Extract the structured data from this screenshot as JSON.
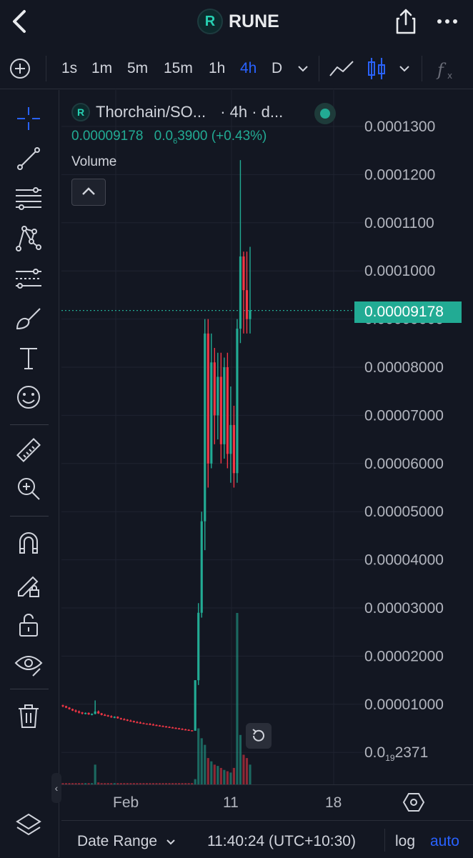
{
  "header": {
    "title": "RUNE",
    "logo_letter": "R"
  },
  "toolbar": {
    "timeframes": [
      "1s",
      "1m",
      "5m",
      "15m",
      "1h",
      "4h",
      "D"
    ],
    "active_timeframe": "4h"
  },
  "legend": {
    "symbol": "Thorchain/SO...",
    "meta": "· 4h · d...",
    "last": "0.00009178",
    "change_prefix": "0.0",
    "change_sub": "6",
    "change_rest": "3900 (+0.43%)",
    "volume_label": "Volume"
  },
  "price_axis": {
    "labels": [
      "0.0001300",
      "0.0001200",
      "0.0001100",
      "0.0001000",
      "0.00009000",
      "0.00008000",
      "0.00007000",
      "0.00006000",
      "0.00005000",
      "0.00004000",
      "0.00003000",
      "0.00002000",
      "0.00001000"
    ],
    "bottom_label_prefix": "0.0",
    "bottom_label_sub": "19",
    "bottom_label_rest": "2371",
    "last_price": "0.00009178"
  },
  "time_axis": {
    "labels": [
      "Feb",
      "11",
      "18"
    ]
  },
  "bottom_bar": {
    "date_range": "Date Range",
    "clock": "11:40:24 (UTC+10:30)",
    "log": "log",
    "auto": "auto"
  },
  "colors": {
    "up": "#22ab94",
    "down": "#f23645",
    "accent": "#2962ff",
    "background": "#131722"
  },
  "chart_data": {
    "type": "candlestick",
    "timeframe": "4h",
    "price_range": [
      2.4e-06,
      0.000135
    ],
    "candles": [
      {
        "o": 9.8e-06,
        "h": 9.9e-06,
        "l": 9.4e-06,
        "c": 9.6e-06
      },
      {
        "o": 9.6e-06,
        "h": 9.7e-06,
        "l": 9.2e-06,
        "c": 9.3e-06
      },
      {
        "o": 9.3e-06,
        "h": 9.4e-06,
        "l": 8.9e-06,
        "c": 9e-06
      },
      {
        "o": 9e-06,
        "h": 9.1e-06,
        "l": 8.6e-06,
        "c": 8.7e-06
      },
      {
        "o": 8.7e-06,
        "h": 8.9e-06,
        "l": 8.3e-06,
        "c": 8.5e-06
      },
      {
        "o": 8.5e-06,
        "h": 8.7e-06,
        "l": 8.1e-06,
        "c": 8.3e-06
      },
      {
        "o": 8.3e-06,
        "h": 8.4e-06,
        "l": 7.9e-06,
        "c": 8.1e-06
      },
      {
        "o": 8.1e-06,
        "h": 8.3e-06,
        "l": 7.9e-06,
        "c": 8.2e-06
      },
      {
        "o": 8.2e-06,
        "h": 8.3e-06,
        "l": 7.8e-06,
        "c": 7.9e-06
      },
      {
        "o": 7.9e-06,
        "h": 8.1e-06,
        "l": 7.7e-06,
        "c": 8e-06
      },
      {
        "o": 8e-06,
        "h": 1.08e-05,
        "l": 7.9e-06,
        "c": 8.5e-06
      },
      {
        "o": 8.5e-06,
        "h": 8.7e-06,
        "l": 8e-06,
        "c": 8.1e-06
      },
      {
        "o": 8.1e-06,
        "h": 8.2e-06,
        "l": 7.7e-06,
        "c": 7.8e-06
      },
      {
        "o": 7.8e-06,
        "h": 8e-06,
        "l": 7.6e-06,
        "c": 7.7e-06
      },
      {
        "o": 7.7e-06,
        "h": 7.8e-06,
        "l": 7.4e-06,
        "c": 7.5e-06
      },
      {
        "o": 7.5e-06,
        "h": 7.7e-06,
        "l": 7.2e-06,
        "c": 7.3e-06
      },
      {
        "o": 7.3e-06,
        "h": 7.5e-06,
        "l": 7.1e-06,
        "c": 7.4e-06
      },
      {
        "o": 7.4e-06,
        "h": 7.5e-06,
        "l": 7e-06,
        "c": 7.1e-06
      },
      {
        "o": 7.1e-06,
        "h": 7.2e-06,
        "l": 6.8e-06,
        "c": 6.9e-06
      },
      {
        "o": 6.9e-06,
        "h": 7.1e-06,
        "l": 6.7e-06,
        "c": 6.8e-06
      },
      {
        "o": 6.8e-06,
        "h": 6.9e-06,
        "l": 6.5e-06,
        "c": 6.6e-06
      },
      {
        "o": 6.6e-06,
        "h": 6.8e-06,
        "l": 6.4e-06,
        "c": 6.5e-06
      },
      {
        "o": 6.5e-06,
        "h": 6.6e-06,
        "l": 6.2e-06,
        "c": 6.3e-06
      },
      {
        "o": 6.3e-06,
        "h": 6.5e-06,
        "l": 6.1e-06,
        "c": 6.2e-06
      },
      {
        "o": 6.2e-06,
        "h": 6.4e-06,
        "l": 6e-06,
        "c": 6.1e-06
      },
      {
        "o": 6.1e-06,
        "h": 6.2e-06,
        "l": 5.9e-06,
        "c": 6e-06
      },
      {
        "o": 6e-06,
        "h": 3.5e-06,
        "l": 5.8e-06,
        "c": 5.9e-06
      },
      {
        "o": 5.9e-06,
        "h": 6.1e-06,
        "l": 5.7e-06,
        "c": 5.8e-06
      },
      {
        "o": 5.8e-06,
        "h": 6e-06,
        "l": 5.6e-06,
        "c": 5.7e-06
      },
      {
        "o": 5.7e-06,
        "h": 5.8e-06,
        "l": 5.5e-06,
        "c": 5.6e-06
      },
      {
        "o": 5.6e-06,
        "h": 5.7e-06,
        "l": 5.4e-06,
        "c": 5.5e-06
      },
      {
        "o": 5.5e-06,
        "h": 5.6e-06,
        "l": 5.3e-06,
        "c": 5.4e-06
      },
      {
        "o": 5.4e-06,
        "h": 5.5e-06,
        "l": 5.2e-06,
        "c": 5.3e-06
      },
      {
        "o": 5.3e-06,
        "h": 5.4e-06,
        "l": 5.1e-06,
        "c": 5.2e-06
      },
      {
        "o": 5.2e-06,
        "h": 5.3e-06,
        "l": 5e-06,
        "c": 5.1e-06
      },
      {
        "o": 5.1e-06,
        "h": 5.2e-06,
        "l": 4.9e-06,
        "c": 5e-06
      },
      {
        "o": 5e-06,
        "h": 5.1e-06,
        "l": 4.8e-06,
        "c": 4.9e-06
      },
      {
        "o": 4.9e-06,
        "h": 5e-06,
        "l": 4.7e-06,
        "c": 4.8e-06
      },
      {
        "o": 4.8e-06,
        "h": 4.9e-06,
        "l": 4.6e-06,
        "c": 4.7e-06
      },
      {
        "o": 4.7e-06,
        "h": 4.8e-06,
        "l": 4.5e-06,
        "c": 4.6e-06
      },
      {
        "o": 4.6e-06,
        "h": 4.6e-06,
        "l": 4.4e-06,
        "c": 4.5e-06
      },
      {
        "o": 4.5e-06,
        "h": 3e-06,
        "l": 4.6e-06,
        "c": 1.5e-05
      },
      {
        "o": 1.5e-05,
        "h": 3.1e-05,
        "l": 1.4e-05,
        "c": 2.9e-05
      },
      {
        "o": 2.9e-05,
        "h": 5e-05,
        "l": 2.8e-05,
        "c": 4.8e-05
      },
      {
        "o": 4.8e-05,
        "h": 9e-05,
        "l": 4.2e-05,
        "c": 8.7e-05
      },
      {
        "o": 8.7e-05,
        "h": 9e-05,
        "l": 5.5e-05,
        "c": 6e-05
      },
      {
        "o": 6e-05,
        "h": 8.7e-05,
        "l": 5.9e-05,
        "c": 8.1e-05
      },
      {
        "o": 8.1e-05,
        "h": 8.4e-05,
        "l": 6.4e-05,
        "c": 7e-05
      },
      {
        "o": 7e-05,
        "h": 8.3e-05,
        "l": 6.5e-05,
        "c": 7.8e-05
      },
      {
        "o": 7.8e-05,
        "h": 8.3e-05,
        "l": 6e-05,
        "c": 6.4e-05
      },
      {
        "o": 6.4e-05,
        "h": 8.2e-05,
        "l": 6.1e-05,
        "c": 8e-05
      },
      {
        "o": 8e-05,
        "h": 8.3e-05,
        "l": 5.9e-05,
        "c": 6.2e-05
      },
      {
        "o": 6.2e-05,
        "h": 7.6e-05,
        "l": 5.6e-05,
        "c": 6.8e-05
      },
      {
        "o": 6.8e-05,
        "h": 7.2e-05,
        "l": 5.5e-05,
        "c": 5.8e-05
      },
      {
        "o": 5.8e-05,
        "h": 9e-05,
        "l": 5.6e-05,
        "c": 8.8e-05
      },
      {
        "o": 8.8e-05,
        "h": 0.000123,
        "l": 8.5e-05,
        "c": 0.000103
      },
      {
        "o": 0.000103,
        "h": 0.000104,
        "l": 8.7e-05,
        "c": 9.6e-05
      },
      {
        "o": 9.6e-05,
        "h": 0.000104,
        "l": 8.7e-05,
        "c": 9e-05
      },
      {
        "o": 9e-05,
        "h": 0.000105,
        "l": 8.7e-05,
        "c": 9.18e-05
      }
    ],
    "volume": [
      2,
      2,
      2,
      2,
      2,
      2,
      2,
      2,
      2,
      2,
      30,
      3,
      2,
      2,
      2,
      2,
      2,
      2,
      2,
      2,
      2,
      2,
      2,
      2,
      2,
      2,
      2,
      2,
      2,
      2,
      2,
      2,
      2,
      2,
      2,
      2,
      2,
      2,
      2,
      2,
      2,
      8,
      85,
      70,
      60,
      40,
      35,
      30,
      28,
      25,
      22,
      20,
      18,
      25,
      260,
      75,
      45,
      40,
      30
    ],
    "x_ticks": [
      "Feb",
      "11",
      "18"
    ],
    "last_price": 9.178e-05
  }
}
